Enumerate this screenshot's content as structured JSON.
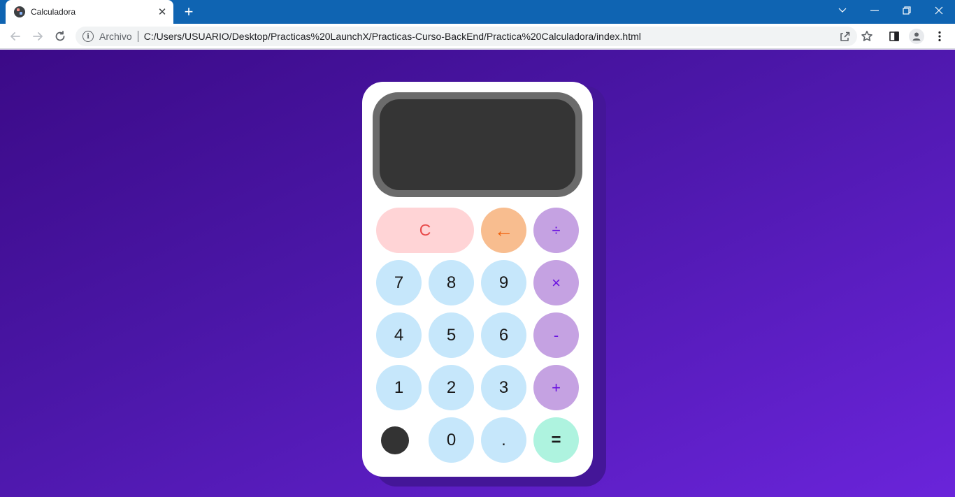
{
  "browser": {
    "tab": {
      "title": "Calculadora",
      "close_glyph": "✕",
      "favicon": "globe-app-icon"
    },
    "new_tab_glyph": "+",
    "address": {
      "scheme_label": "Archivo",
      "url": "C:/Users/USUARIO/Desktop/Practicas%20LaunchX/Practicas-Curso-BackEnd/Practica%20Calculadora/index.html"
    },
    "icons": [
      "back-arrow-icon",
      "forward-arrow-icon",
      "reload-icon",
      "info-icon",
      "share-icon",
      "star-icon",
      "side-panel-icon",
      "profile-icon",
      "menu-dots-icon",
      "chevron-down-icon",
      "minimize-icon",
      "restore-icon",
      "close-icon"
    ]
  },
  "calculator": {
    "display": {
      "value": ""
    },
    "keys": {
      "clear": "C",
      "backspace": "←",
      "divide": "÷",
      "multiply": "×",
      "subtract": "-",
      "add": "+",
      "equals": "=",
      "decimal": ".",
      "d0": "0",
      "d1": "1",
      "d2": "2",
      "d3": "3",
      "d4": "4",
      "d5": "5",
      "d6": "6",
      "d7": "7",
      "d8": "8",
      "d9": "9"
    },
    "colors": {
      "background_start": "#3b0a87",
      "background_end": "#6a24da",
      "number_key": "#c6e7fb",
      "operator_key": "#c5a2e2",
      "clear_key": "#ffd4d6",
      "backspace_key": "#f8bd8f",
      "equals_key": "#aef3df",
      "screen": "#353535"
    }
  }
}
